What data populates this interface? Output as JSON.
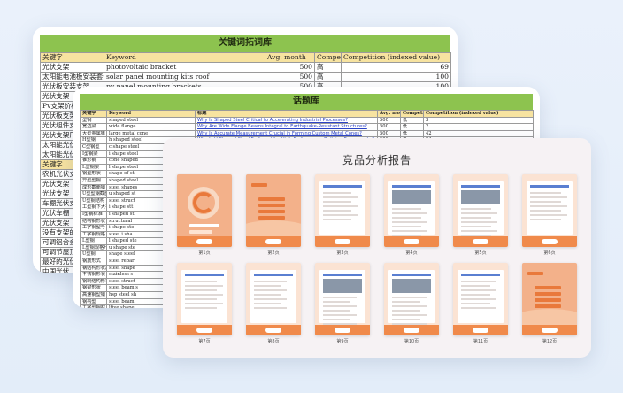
{
  "sheet1": {
    "title": "关键词拓词库",
    "headers": [
      "关键字",
      "Keyword",
      "Avg. month",
      "Competitie",
      "Competition (indexed value)"
    ],
    "rows": [
      [
        "光伏支架",
        "photovoltaic bracket",
        "500",
        "高",
        "69"
      ],
      [
        "太阳能电池板安装套件屋顶",
        "solar panel mounting kits roof",
        "500",
        "高",
        "100"
      ],
      [
        "光伏板安装支架",
        "pv panel mounting brackets",
        "500",
        "高",
        "100"
      ],
      [
        "光伏支架",
        "",
        "",
        "",
        ""
      ],
      [
        "Pv支架价格",
        "",
        "",
        "",
        ""
      ],
      [
        "光伏板支架",
        "",
        "",
        "",
        ""
      ],
      [
        "光伏组件支架",
        "",
        "",
        "",
        ""
      ],
      [
        "光伏支架厂",
        "",
        "",
        "",
        ""
      ],
      [
        "太阳能光伏",
        "",
        "",
        "",
        ""
      ],
      [
        "太阳能光伏",
        "",
        "",
        "",
        ""
      ]
    ],
    "headers2": [
      "关键字",
      "",
      "",
      "",
      ""
    ],
    "rows2": [
      [
        "农机光伏支架",
        "",
        "",
        "",
        ""
      ],
      [
        "光伏支架",
        "",
        "",
        "",
        ""
      ],
      [
        "光伏支架",
        "",
        "",
        "",
        ""
      ],
      [
        "车棚光伏支架",
        "",
        "",
        "",
        ""
      ],
      [
        "光伏车棚",
        "",
        "",
        "",
        ""
      ],
      [
        "光伏支架",
        "",
        "",
        "",
        ""
      ],
      [
        "没有支架的",
        "",
        "",
        "",
        ""
      ],
      [
        "可调铝合金",
        "",
        "",
        "",
        ""
      ],
      [
        "可调节屋顶",
        "",
        "",
        "",
        ""
      ],
      [
        "最好的光伏",
        "",
        "",
        "",
        ""
      ],
      [
        "中国光伏",
        "",
        "",
        "",
        ""
      ]
    ]
  },
  "sheet2": {
    "title": "话题库",
    "headers": [
      "关键字",
      "Keyword",
      "标题",
      "Avg. mor",
      "Competit",
      "Competition (indexed value)"
    ],
    "rows": [
      [
        "型钢",
        "shaped steel",
        "Why Is Shaped Steel Critical to Accelerating Industrial Processes?",
        "500",
        "低",
        "3"
      ],
      [
        "宽边梁",
        "wide flange",
        "Why Are Wide Flange Beams Integral to Earthquake-Resistant Structures?",
        "500",
        "低",
        "2"
      ],
      [
        "大型金属锥",
        "large metal cone",
        "Why Is Accurate Measurement Crucial in Forming Custom Metal Cones?",
        "500",
        "低",
        "42"
      ],
      [
        "H型钢",
        "h shaped steel",
        "Why Is H Shaped Steel Preferred for High-Performance Building Frameworks?",
        "500",
        "低",
        "24"
      ],
      [
        "C型钢型",
        "c shape steel",
        "",
        "",
        "",
        ""
      ],
      [
        "I型钢梁",
        "i shape steel",
        "",
        "",
        "",
        ""
      ],
      [
        "锥形钢",
        "cone shaped",
        "",
        "",
        "",
        ""
      ],
      [
        "L型钢梁",
        "l shape steel",
        "",
        "",
        "",
        ""
      ],
      [
        "钢型形状",
        "shape of st",
        "",
        "",
        "",
        ""
      ],
      [
        "异型型钢",
        "shaped steel",
        "",
        "",
        "",
        ""
      ],
      [
        "成形截面钢",
        "steel shapes",
        "",
        "",
        "",
        ""
      ],
      [
        "U型型钢截面",
        "u shaped st",
        "",
        "",
        "",
        ""
      ],
      [
        "U型钢结构",
        "steel struct",
        "",
        "",
        "",
        ""
      ],
      [
        "工型钢下大平梁",
        "i shape stt",
        "",
        "",
        "",
        ""
      ],
      [
        "I型钢标准",
        "i shaped st",
        "",
        "",
        "",
        ""
      ],
      [
        "结构钢形状",
        "structural",
        "",
        "",
        "",
        ""
      ],
      [
        "工字钢型号",
        "i shape ste",
        "",
        "",
        "",
        ""
      ],
      [
        "工字钢规格",
        "steel i sha",
        "",
        "",
        "",
        ""
      ],
      [
        "L型钢",
        "l shaped ste",
        "",
        "",
        "",
        ""
      ],
      [
        "L型钢规格尺寸",
        "u shape ste",
        "",
        "",
        "",
        ""
      ],
      [
        "U型钢",
        "shape steel",
        "",
        "",
        "",
        ""
      ],
      [
        "钢筋形式",
        "steel rebar",
        "",
        "",
        "",
        ""
      ],
      [
        "钢结构形状尺寸",
        "steel shape",
        "",
        "",
        "",
        ""
      ],
      [
        "不锈钢形状",
        "stainless s",
        "",
        "",
        "",
        ""
      ],
      [
        "钢制结构形状",
        "steel struct",
        "",
        "",
        "",
        ""
      ],
      [
        "钢梁形状",
        "steel beam s",
        "",
        "",
        "",
        ""
      ],
      [
        "高速钢型钢",
        "hsp steel sh",
        "",
        "",
        "",
        ""
      ],
      [
        "钢构型",
        "steel beam",
        "",
        "",
        "",
        ""
      ],
      [
        "工字型钢材",
        "ltive shape",
        "",
        "",
        "",
        ""
      ],
      [
        "结构钢形状",
        "structural s",
        "",
        "",
        "",
        ""
      ],
      [
        "U型钢管",
        "u shaped ste",
        "",
        "",
        "",
        ""
      ],
      [
        "C型钢",
        "c shape ste",
        "",
        "",
        "",
        ""
      ]
    ]
  },
  "report": {
    "title": "竞品分析报告",
    "pages": [
      {
        "label": "第1页"
      },
      {
        "label": "第2页"
      },
      {
        "label": "第3页"
      },
      {
        "label": "第4页"
      },
      {
        "label": "第5页"
      },
      {
        "label": "第6页"
      },
      {
        "label": "第7页"
      },
      {
        "label": "第8页"
      },
      {
        "label": "第9页"
      },
      {
        "label": "第10页"
      },
      {
        "label": "第11页"
      },
      {
        "label": "第12页"
      }
    ]
  }
}
